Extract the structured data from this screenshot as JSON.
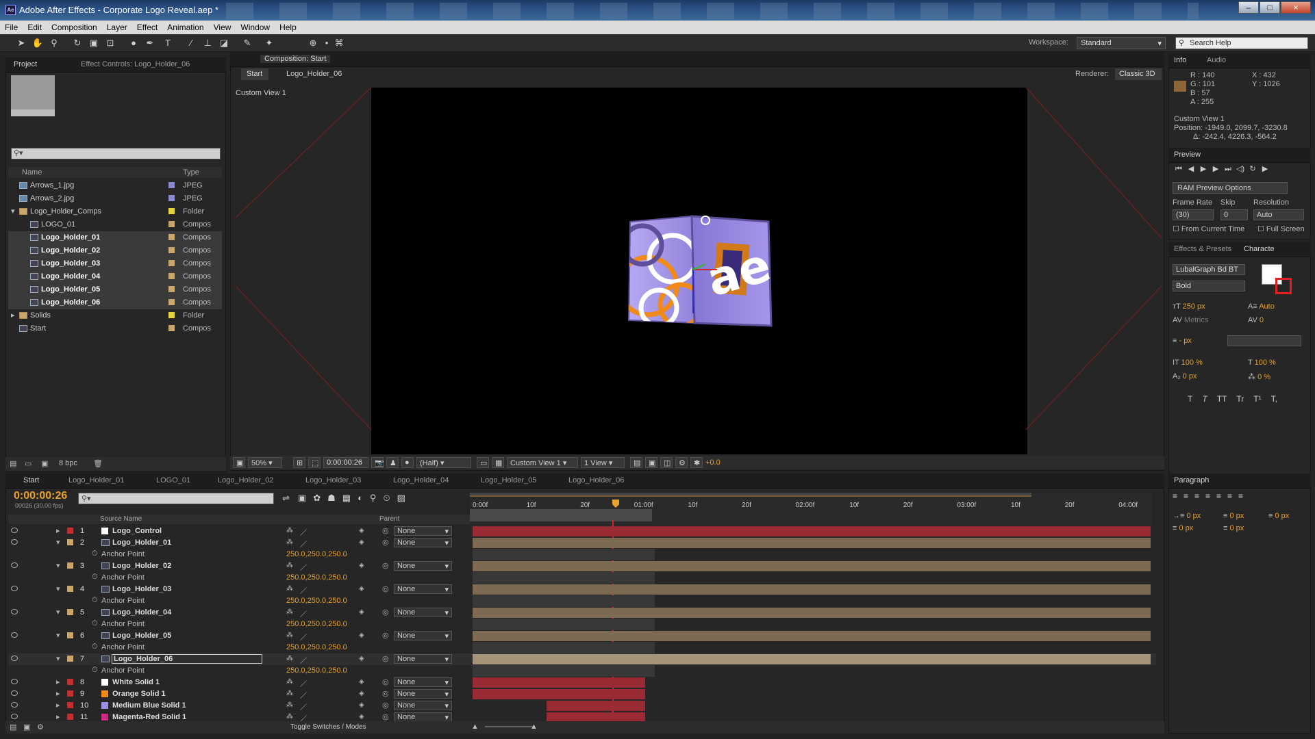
{
  "window": {
    "title": "Adobe After Effects - Corporate Logo Reveal.aep *",
    "logo": "Ae",
    "controls": [
      "–",
      "□",
      "×"
    ]
  },
  "menu": [
    "File",
    "Edit",
    "Composition",
    "Layer",
    "Effect",
    "Animation",
    "View",
    "Window",
    "Help"
  ],
  "toolbar": {
    "workspace_label": "Workspace:",
    "workspace_value": "Standard",
    "search_placeholder": "Search Help"
  },
  "project": {
    "tabs": [
      "Project",
      "Effect Controls: Logo_Holder_06"
    ],
    "columns": {
      "name": "Name",
      "type": "Type"
    },
    "items": [
      {
        "name": "Arrows_1.jpg",
        "type": "JPEG",
        "label": "#8a8acc",
        "indent": 0,
        "sel": false,
        "kind": "img"
      },
      {
        "name": "Arrows_2.jpg",
        "type": "JPEG",
        "label": "#8a8acc",
        "indent": 0,
        "sel": false,
        "kind": "img"
      },
      {
        "name": "Logo_Holder_Comps",
        "type": "Folder",
        "label": "#e6d23a",
        "indent": 0,
        "sel": false,
        "kind": "folder"
      },
      {
        "name": "LOGO_01",
        "type": "Compos",
        "label": "#c8a66e",
        "indent": 1,
        "sel": false,
        "kind": "comp"
      },
      {
        "name": "Logo_Holder_01",
        "type": "Compos",
        "label": "#c8a66e",
        "indent": 1,
        "sel": true,
        "kind": "comp"
      },
      {
        "name": "Logo_Holder_02",
        "type": "Compos",
        "label": "#c8a66e",
        "indent": 1,
        "sel": true,
        "kind": "comp"
      },
      {
        "name": "Logo_Holder_03",
        "type": "Compos",
        "label": "#c8a66e",
        "indent": 1,
        "sel": true,
        "kind": "comp"
      },
      {
        "name": "Logo_Holder_04",
        "type": "Compos",
        "label": "#c8a66e",
        "indent": 1,
        "sel": true,
        "kind": "comp"
      },
      {
        "name": "Logo_Holder_05",
        "type": "Compos",
        "label": "#c8a66e",
        "indent": 1,
        "sel": true,
        "kind": "comp"
      },
      {
        "name": "Logo_Holder_06",
        "type": "Compos",
        "label": "#c8a66e",
        "indent": 1,
        "sel": true,
        "kind": "comp"
      },
      {
        "name": "Solids",
        "type": "Folder",
        "label": "#e6d23a",
        "indent": 0,
        "sel": false,
        "kind": "folder"
      },
      {
        "name": "Start",
        "type": "Compos",
        "label": "#c8a66e",
        "indent": 0,
        "sel": false,
        "kind": "comp"
      }
    ],
    "bpc": "8 bpc"
  },
  "composition": {
    "tab": "Composition: Start",
    "breadcrumb": [
      "Start",
      "Logo_Holder_06"
    ],
    "renderer_label": "Renderer:",
    "renderer_value": "Classic 3D",
    "view_label": "Custom View 1",
    "zoom": "50%",
    "timecode": "0:00:00:26",
    "resolution": "(Half)",
    "view_select": "Custom View 1",
    "views": "1 View",
    "exposure": "+0.0"
  },
  "info": {
    "tabs": [
      "Info",
      "Audio"
    ],
    "r": "R : 140",
    "g": "G : 101",
    "b": "B : 57",
    "a": "A : 255",
    "x": "X : 432",
    "y": "Y : 1026",
    "swatch": "#8c6539",
    "view": "Custom View 1",
    "position": "Position: -1949.0, 2099.7, -3230.8",
    "delta": "Δ: -242.4, 4226.3, -564.2"
  },
  "preview": {
    "tab": "Preview",
    "ram_options": "RAM Preview Options",
    "frame_rate_label": "Frame Rate",
    "skip_label": "Skip",
    "resolution_label": "Resolution",
    "frame_rate": "(30)",
    "skip": "0",
    "resolution": "Auto",
    "from_current": "From Current Time",
    "full_screen": "Full Screen"
  },
  "character": {
    "tabs": [
      "Effects & Presets",
      "Characte"
    ],
    "font": "LubalGraph Bd BT",
    "style": "Bold",
    "size": "250 px",
    "leading": "Auto",
    "kerning": "Metrics",
    "tracking": "0",
    "stroke": "- px",
    "vscale": "100 %",
    "hscale": "100 %",
    "baseline": "0 px",
    "tsume": "0 %",
    "styles": [
      "T",
      "T",
      "TT",
      "Tr",
      "T¹",
      "T,"
    ]
  },
  "paragraph": {
    "tab": "Paragraph",
    "indents": [
      "0 px",
      "0 px",
      "0 px",
      "0 px",
      "0 px"
    ]
  },
  "timeline": {
    "tabs": [
      "Start",
      "Logo_Holder_01",
      "LOGO_01",
      "Logo_Holder_02",
      "Logo_Holder_03",
      "Logo_Holder_04",
      "Logo_Holder_05",
      "Logo_Holder_06"
    ],
    "timecode": "0:00:00:26",
    "fps": "00026 (30.00 fps)",
    "columns": {
      "source": "Source Name",
      "parent": "Parent"
    },
    "ruler": [
      "0:00f",
      "10f",
      "20f",
      "01:00f",
      "10f",
      "20f",
      "02:00f",
      "10f",
      "20f",
      "03:00f",
      "10f",
      "20f",
      "04:00f"
    ],
    "toggle_label": "Toggle Switches / Modes",
    "layers": [
      {
        "num": "1",
        "name": "Logo_Control",
        "color": "#ffffff",
        "label": "#c03030",
        "bar": "red-full",
        "expanded": false
      },
      {
        "num": "2",
        "name": "Logo_Holder_01",
        "color": "",
        "label": "#c8a66e",
        "bar": "tan",
        "expanded": true,
        "prop": "Anchor Point",
        "value": "250.0,250.0,250.0"
      },
      {
        "num": "3",
        "name": "Logo_Holder_02",
        "color": "",
        "label": "#c8a66e",
        "bar": "tan",
        "expanded": true,
        "prop": "Anchor Point",
        "value": "250.0,250.0,250.0"
      },
      {
        "num": "4",
        "name": "Logo_Holder_03",
        "color": "",
        "label": "#c8a66e",
        "bar": "tan",
        "expanded": true,
        "prop": "Anchor Point",
        "value": "250.0,250.0,250.0"
      },
      {
        "num": "5",
        "name": "Logo_Holder_04",
        "color": "",
        "label": "#c8a66e",
        "bar": "tan",
        "expanded": true,
        "prop": "Anchor Point",
        "value": "250.0,250.0,250.0"
      },
      {
        "num": "6",
        "name": "Logo_Holder_05",
        "color": "",
        "label": "#c8a66e",
        "bar": "tan",
        "expanded": true,
        "prop": "Anchor Point",
        "value": "250.0,250.0,250.0"
      },
      {
        "num": "7",
        "name": "Logo_Holder_06",
        "color": "",
        "label": "#c8a66e",
        "bar": "tan-sel",
        "expanded": true,
        "prop": "Anchor Point",
        "value": "250.0,250.0,250.0"
      },
      {
        "num": "8",
        "name": "White Solid 1",
        "color": "#ffffff",
        "label": "#c03030",
        "bar": "red-short",
        "expanded": false
      },
      {
        "num": "9",
        "name": "Orange Solid 1",
        "color": "#f08a18",
        "label": "#c03030",
        "bar": "red-short",
        "expanded": false
      },
      {
        "num": "10",
        "name": "Medium Blue Solid 1",
        "color": "#9e8ee8",
        "label": "#c03030",
        "bar": "red-late",
        "expanded": false
      },
      {
        "num": "11",
        "name": "Magenta-Red Solid 1",
        "color": "#d02880",
        "label": "#c03030",
        "bar": "red-late",
        "expanded": false
      }
    ],
    "parent_none": "None"
  }
}
